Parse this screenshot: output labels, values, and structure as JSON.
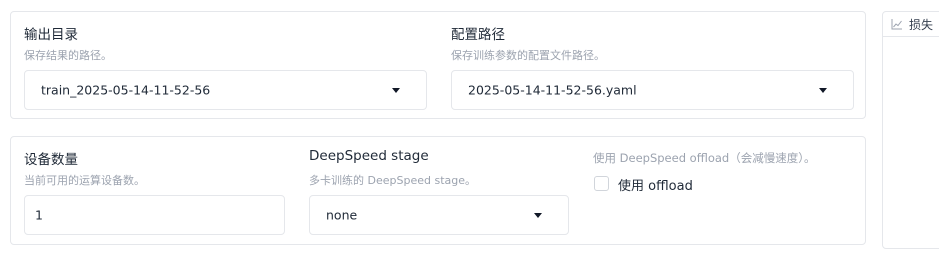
{
  "output": {
    "label": "输出目录",
    "info": "保存结果的路径。",
    "value": "train_2025-05-14-11-52-56"
  },
  "config": {
    "label": "配置路径",
    "info": "保存训练参数的配置文件路径。",
    "value": "2025-05-14-11-52-56.yaml"
  },
  "devices": {
    "label": "设备数量",
    "info": "当前可用的运算设备数。",
    "value": "1"
  },
  "deepspeed": {
    "label": "DeepSpeed stage",
    "info": "多卡训练的 DeepSpeed stage。",
    "value": "none"
  },
  "offload": {
    "label": "使用 DeepSpeed offload（会减慢速度）。",
    "checkbox_label": "使用 offload",
    "checked": false
  },
  "loss_panel": {
    "label": "损失",
    "icon": "line-chart-icon"
  }
}
